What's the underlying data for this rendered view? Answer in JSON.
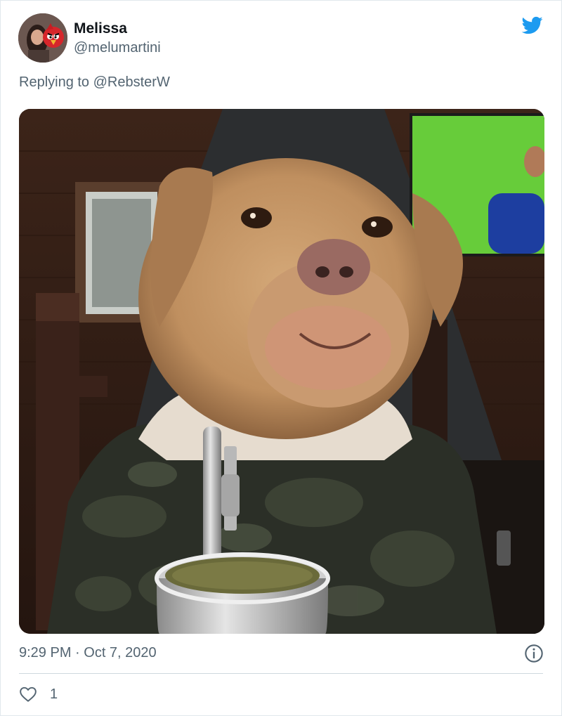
{
  "tweet": {
    "author": {
      "display_name": "Melissa",
      "handle": "@melumartini"
    },
    "reply_context": {
      "prefix": "Replying to",
      "mention": "@RebsterW"
    },
    "timestamp": "9:29 PM · Oct 7, 2020",
    "likes": "1"
  },
  "icons": {
    "brand": "twitter-bird-icon",
    "info": "info-icon",
    "like": "heart-icon"
  },
  "colors": {
    "brand_blue": "#1d9bf0",
    "secondary_text": "#536471",
    "divider": "#cfd9de"
  }
}
